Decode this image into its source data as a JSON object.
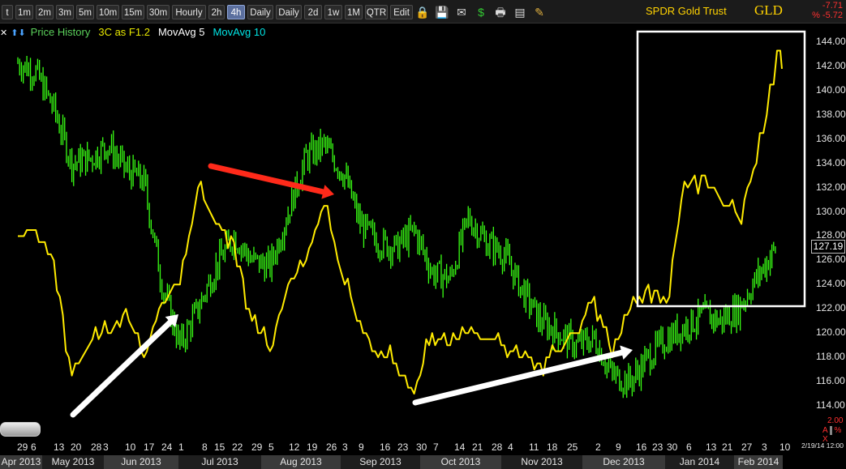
{
  "toolbar": {
    "intervals": [
      "t",
      "1m",
      "2m",
      "3m",
      "5m",
      "10m",
      "15m",
      "30m",
      "Hourly",
      "2h",
      "4h",
      "Daily",
      "Daily",
      "2d",
      "1w",
      "1M",
      "QTR",
      "Edit"
    ],
    "active_interval": "4h",
    "icons": [
      "lock-icon",
      "save-icon",
      "mail-icon",
      "dollar-icon",
      "print-icon",
      "chart-settings-icon",
      "pencil-icon"
    ],
    "title": "SPDR Gold Trust",
    "ticker": "GLD",
    "change_points": "-7.71",
    "change_percent": "% -5.72"
  },
  "legend": {
    "price": "Price History",
    "indicator": "3C as F1.2",
    "ma5": "MovAvg 5",
    "ma10": "MovAvg 10"
  },
  "colors": {
    "price": "#39ff14",
    "indicator": "#ffeb00",
    "legend_price": "#5bd15b",
    "legend_indicator": "#e8e800",
    "legend_ma5": "#ffffff",
    "legend_ma10": "#00e5e5",
    "red_arrow": "#ff2a1a",
    "white_arrow": "#ffffff",
    "box": "#ffffff"
  },
  "chart_data": {
    "type": "line",
    "title": "SPDR Gold Trust",
    "ylim": [
      113,
      145
    ],
    "yticks": [
      114,
      116,
      118,
      120,
      122,
      124,
      126,
      128,
      130,
      132,
      134,
      136,
      138,
      140,
      142,
      144
    ],
    "last_price": "127.19",
    "x_day_labels": [
      "29",
      "6",
      "13",
      "20",
      "28",
      "3",
      "10",
      "17",
      "24",
      "1",
      "8",
      "15",
      "22",
      "29",
      "5",
      "12",
      "19",
      "26",
      "3",
      "9",
      "16",
      "23",
      "30",
      "7",
      "14",
      "21",
      "28",
      "4",
      "11",
      "18",
      "25",
      "2",
      "9",
      "16",
      "23",
      "30",
      "6",
      "13",
      "21",
      "27",
      "3",
      "10"
    ],
    "x_month_labels": [
      "Apr 2013",
      "May 2013",
      "Jun 2013",
      "Jul 2013",
      "Aug 2013",
      "Sep 2013",
      "Oct 2013",
      "Nov 2013",
      "Dec 2013",
      "Jan 2014",
      "Feb 2014"
    ],
    "series": [
      {
        "name": "Price History",
        "x": [
          "2013-04-29",
          "2013-05-06",
          "2013-05-13",
          "2013-05-20",
          "2013-05-28",
          "2013-06-03",
          "2013-06-10",
          "2013-06-17",
          "2013-06-24",
          "2013-07-01",
          "2013-07-08",
          "2013-07-15",
          "2013-07-22",
          "2013-07-29",
          "2013-08-05",
          "2013-08-12",
          "2013-08-19",
          "2013-08-26",
          "2013-09-03",
          "2013-09-09",
          "2013-09-16",
          "2013-09-23",
          "2013-09-30",
          "2013-10-07",
          "2013-10-14",
          "2013-10-21",
          "2013-10-28",
          "2013-11-04",
          "2013-11-11",
          "2013-11-18",
          "2013-11-25",
          "2013-12-02",
          "2013-12-09",
          "2013-12-16",
          "2013-12-23",
          "2013-12-30",
          "2014-01-06",
          "2014-01-13",
          "2014-01-21",
          "2014-01-27",
          "2014-02-03",
          "2014-02-10",
          "2014-02-18"
        ],
        "values": [
          142.3,
          141.5,
          138.5,
          134.0,
          134.5,
          135.5,
          133.5,
          132.5,
          124.0,
          119.0,
          122.0,
          125.5,
          128.0,
          126.0,
          125.5,
          130.0,
          134.5,
          135.5,
          133.0,
          129.0,
          127.5,
          127.0,
          128.5,
          125.0,
          124.5,
          129.5,
          127.5,
          126.5,
          123.5,
          121.0,
          120.0,
          119.0,
          119.5,
          116.5,
          116.0,
          118.0,
          119.5,
          120.5,
          121.5,
          121.0,
          122.0,
          124.5,
          127.2
        ]
      },
      {
        "name": "3C as F1.2",
        "x": [
          "2013-04-29",
          "2013-05-06",
          "2013-05-13",
          "2013-05-20",
          "2013-05-28",
          "2013-06-03",
          "2013-06-10",
          "2013-06-17",
          "2013-06-24",
          "2013-07-01",
          "2013-07-08",
          "2013-07-15",
          "2013-07-22",
          "2013-07-29",
          "2013-08-05",
          "2013-08-12",
          "2013-08-19",
          "2013-08-26",
          "2013-09-03",
          "2013-09-09",
          "2013-09-16",
          "2013-09-23",
          "2013-09-30",
          "2013-10-07",
          "2013-10-14",
          "2013-10-21",
          "2013-10-28",
          "2013-11-04",
          "2013-11-11",
          "2013-11-18",
          "2013-11-25",
          "2013-12-02",
          "2013-12-09",
          "2013-12-16",
          "2013-12-23",
          "2013-12-30",
          "2014-01-06",
          "2014-01-13",
          "2014-01-21",
          "2014-01-27",
          "2014-02-03",
          "2014-02-10",
          "2014-02-18"
        ],
        "values": [
          128.0,
          128.5,
          126.0,
          116.5,
          119.5,
          120.0,
          122.0,
          118.0,
          122.5,
          124.0,
          132.0,
          129.0,
          127.5,
          121.0,
          118.5,
          124.0,
          126.0,
          130.5,
          124.0,
          121.0,
          118.0,
          117.5,
          115.0,
          120.0,
          119.0,
          120.0,
          119.5,
          119.0,
          118.0,
          117.5,
          118.5,
          120.0,
          123.0,
          118.0,
          122.0,
          124.0,
          122.5,
          132.5,
          133.0,
          131.0,
          129.5,
          134.0,
          142.0
        ]
      }
    ]
  }
}
